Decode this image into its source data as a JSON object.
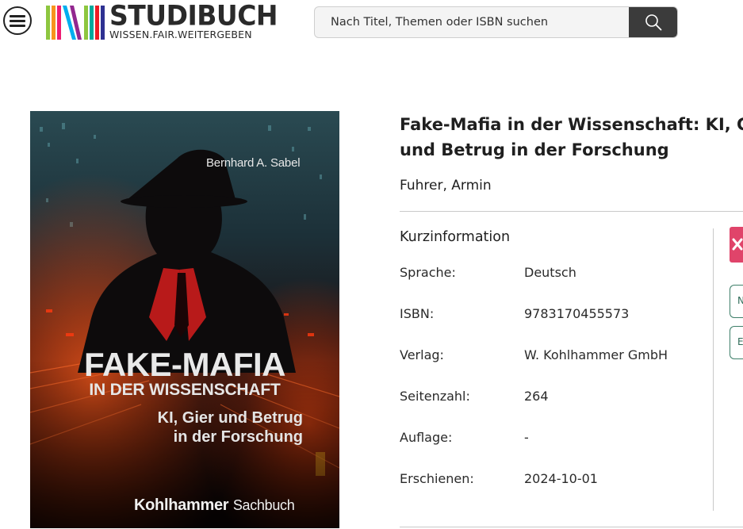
{
  "header": {
    "logo": {
      "brand": "STUDIBUCH",
      "tagline": "WISSEN.FAIR.WEITERGEBEN"
    },
    "search": {
      "placeholder": "Nach Titel, Themen oder ISBN suchen",
      "value": ""
    },
    "icons": {
      "menu": "hamburger-menu-icon",
      "search": "search-icon"
    }
  },
  "cover": {
    "author": "Bernhard A. Sabel",
    "title_line1": "FAKE-MAFIA",
    "title_line2": "IN DER WISSENSCHAFT",
    "subtitle_line1": "KI, Gier und Betrug",
    "subtitle_line2": "in der Forschung",
    "publisher_bold": "Kohlhammer",
    "publisher_light": "Sachbuch"
  },
  "book": {
    "title_line1": "Fake-Mafia in der Wissenschaft: KI, Gier",
    "title_line2": "und Betrug in der Forschung",
    "author": "Fuhrer, Armin"
  },
  "kurzinformation": {
    "heading": "Kurzinformation",
    "rows": [
      {
        "label": "Sprache:",
        "value": "Deutsch"
      },
      {
        "label": "ISBN:",
        "value": "9783170455573"
      },
      {
        "label": "Verlag:",
        "value": "W. Kohlhammer GmbH"
      },
      {
        "label": "Seitenzahl:",
        "value": "264"
      },
      {
        "label": "Auflage:",
        "value": "-"
      },
      {
        "label": "Erschienen:",
        "value": "2024-10-01"
      }
    ]
  },
  "side_actions": {
    "close_icon": "close-icon",
    "button1": "N",
    "button2": "E"
  },
  "colors": {
    "accent_pink": "#e0446a",
    "accent_green": "#3e7f69",
    "search_button": "#3b3b3b"
  }
}
